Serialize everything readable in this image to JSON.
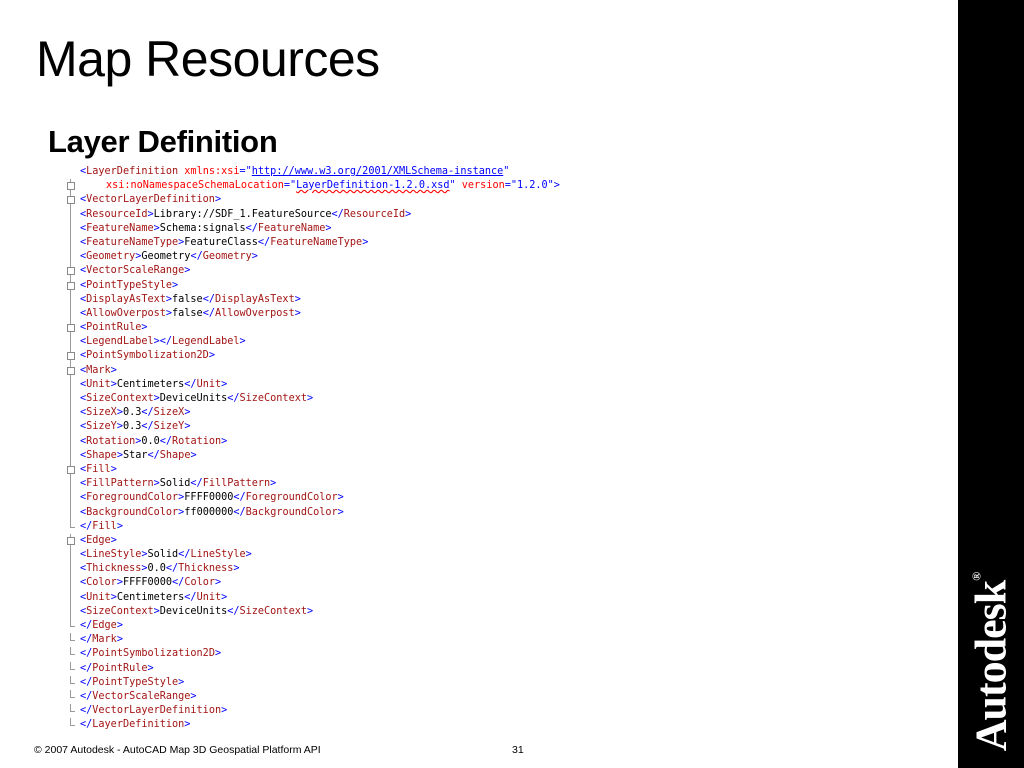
{
  "slide": {
    "title": "Map Resources",
    "subtitle": "Layer Definition",
    "footer": "© 2007 Autodesk - AutoCAD Map 3D Geospatial Platform API",
    "page_number": "31",
    "brand": "Autodesk",
    "brand_mark": "®"
  },
  "code": {
    "root_open": {
      "tag": "LayerDefinition",
      "attr1_name": "xmlns:xsi",
      "attr1_value": "http://www.w3.org/2001/XMLSchema-instance",
      "attr2_name": "xsi:noNamespaceSchemaLocation",
      "attr2_value": "LayerDefinition-1.2.0.xsd",
      "attr3_name": "version",
      "attr3_value": "1.2.0"
    },
    "lines": [
      {
        "tag": "VectorLayerDefinition",
        "value": null,
        "kind": "open"
      },
      {
        "tag": "ResourceId",
        "value": "Library://SDF_1.FeatureSource",
        "kind": "elem"
      },
      {
        "tag": "FeatureName",
        "value": "Schema:signals",
        "kind": "elem"
      },
      {
        "tag": "FeatureNameType",
        "value": "FeatureClass",
        "kind": "elem"
      },
      {
        "tag": "Geometry",
        "value": "Geometry",
        "kind": "elem"
      },
      {
        "tag": "VectorScaleRange",
        "value": null,
        "kind": "open"
      },
      {
        "tag": "PointTypeStyle",
        "value": null,
        "kind": "open"
      },
      {
        "tag": "DisplayAsText",
        "value": "false",
        "kind": "elem"
      },
      {
        "tag": "AllowOverpost",
        "value": "false",
        "kind": "elem"
      },
      {
        "tag": "PointRule",
        "value": null,
        "kind": "open"
      },
      {
        "tag": "LegendLabel",
        "value": "",
        "kind": "elem"
      },
      {
        "tag": "PointSymbolization2D",
        "value": null,
        "kind": "open"
      },
      {
        "tag": "Mark",
        "value": null,
        "kind": "open"
      },
      {
        "tag": "Unit",
        "value": "Centimeters",
        "kind": "elem"
      },
      {
        "tag": "SizeContext",
        "value": "DeviceUnits",
        "kind": "elem"
      },
      {
        "tag": "SizeX",
        "value": "0.3",
        "kind": "elem"
      },
      {
        "tag": "SizeY",
        "value": "0.3",
        "kind": "elem"
      },
      {
        "tag": "Rotation",
        "value": "0.0",
        "kind": "elem"
      },
      {
        "tag": "Shape",
        "value": "Star",
        "kind": "elem"
      },
      {
        "tag": "Fill",
        "value": null,
        "kind": "open"
      },
      {
        "tag": "FillPattern",
        "value": "Solid",
        "kind": "elem"
      },
      {
        "tag": "ForegroundColor",
        "value": "FFFF0000",
        "kind": "elem"
      },
      {
        "tag": "BackgroundColor",
        "value": "ff000000",
        "kind": "elem"
      },
      {
        "tag": "Fill",
        "value": null,
        "kind": "close"
      },
      {
        "tag": "Edge",
        "value": null,
        "kind": "open"
      },
      {
        "tag": "LineStyle",
        "value": "Solid",
        "kind": "elem"
      },
      {
        "tag": "Thickness",
        "value": "0.0",
        "kind": "elem"
      },
      {
        "tag": "Color",
        "value": "FFFF0000",
        "kind": "elem"
      },
      {
        "tag": "Unit",
        "value": "Centimeters",
        "kind": "elem"
      },
      {
        "tag": "SizeContext",
        "value": "DeviceUnits",
        "kind": "elem"
      },
      {
        "tag": "Edge",
        "value": null,
        "kind": "close"
      },
      {
        "tag": "Mark",
        "value": null,
        "kind": "close"
      },
      {
        "tag": "PointSymbolization2D",
        "value": null,
        "kind": "close"
      },
      {
        "tag": "PointRule",
        "value": null,
        "kind": "close"
      },
      {
        "tag": "PointTypeStyle",
        "value": null,
        "kind": "close"
      },
      {
        "tag": "VectorScaleRange",
        "value": null,
        "kind": "close"
      },
      {
        "tag": "VectorLayerDefinition",
        "value": null,
        "kind": "close"
      },
      {
        "tag": "LayerDefinition",
        "value": null,
        "kind": "close"
      }
    ]
  },
  "colors": {
    "tag_name": "#a31515",
    "bracket": "#0000ff",
    "attribute": "#ff0000",
    "brand_bar": "#000000"
  }
}
